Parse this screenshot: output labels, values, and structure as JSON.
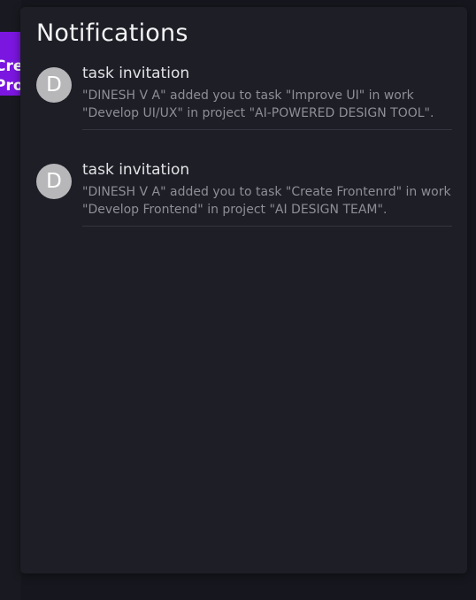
{
  "background": {
    "button_lines": [
      "Crea",
      "Proje"
    ]
  },
  "panel": {
    "title": "Notifications"
  },
  "notifications": [
    {
      "avatar_letter": "D",
      "title": "task invitation",
      "message": "\"DINESH V A\" added you to task \"Improve UI\" in work \"Develop UI/UX\" in project \"AI-POWERED DESIGN TOOL\"."
    },
    {
      "avatar_letter": "D",
      "title": "task invitation",
      "message": "\"DINESH V A\" added you to task \"Create Frontenrd\" in work \"Develop Frontend\" in project \"AI DESIGN TEAM\"."
    }
  ],
  "colors": {
    "accent": "#7b16e0",
    "panel": "#1d1e26",
    "avatar": "#b7b7b9"
  }
}
